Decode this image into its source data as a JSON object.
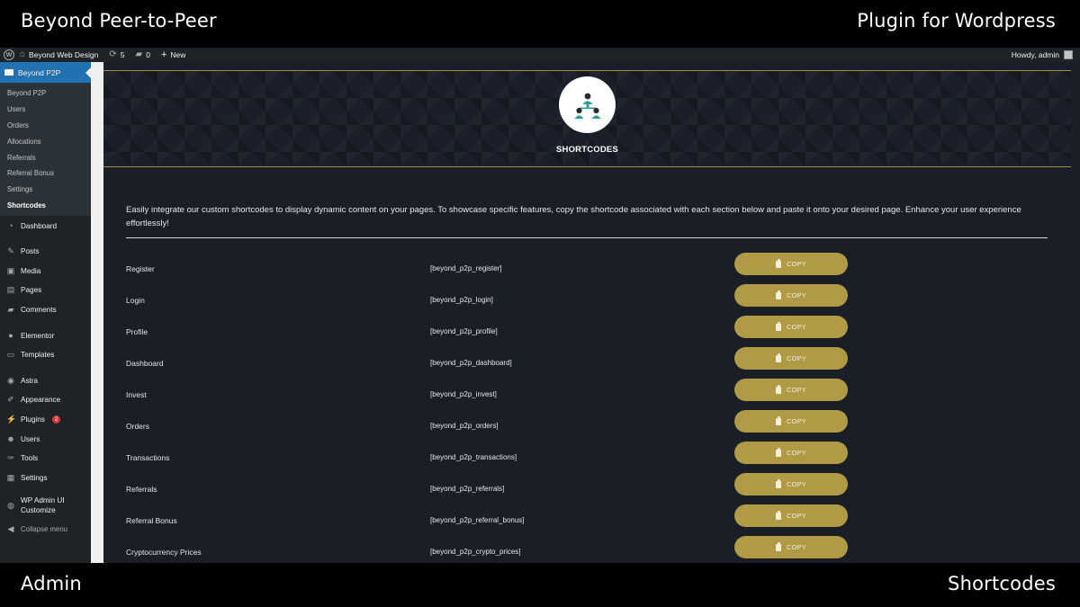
{
  "captions": {
    "top_left": "Beyond Peer-to-Peer",
    "top_right": "Plugin for Wordpress",
    "bottom_left": "Admin",
    "bottom_right": "Shortcodes"
  },
  "adminbar": {
    "site_name": "Beyond Web Design",
    "updates_count": "5",
    "comments_count": "0",
    "new_label": "New",
    "howdy": "Howdy, admin"
  },
  "sidebar": {
    "current": "Beyond P2P",
    "submenu": [
      "Beyond P2P",
      "Users",
      "Orders",
      "Allocations",
      "Referrals",
      "Referral Bonus",
      "Settings",
      "Shortcodes"
    ],
    "menu": {
      "dashboard": "Dashboard",
      "posts": "Posts",
      "media": "Media",
      "pages": "Pages",
      "comments": "Comments",
      "elementor": "Elementor",
      "templates": "Templates",
      "astra": "Astra",
      "appearance": "Appearance",
      "plugins": "Plugins",
      "plugins_badge": "2",
      "users": "Users",
      "tools": "Tools",
      "settings": "Settings",
      "wp_admin_ui_1": "WP Admin UI",
      "wp_admin_ui_2": "Customize",
      "collapse": "Collapse menu"
    }
  },
  "hero": {
    "title": "SHORTCODES",
    "icon": "people-network-icon"
  },
  "intro": "Easily integrate our custom shortcodes to display dynamic content on your pages. To showcase specific features, copy the shortcode associated with each section below and paste it onto your desired page. Enhance your user experience effortlessly!",
  "copy_label": "COPY",
  "shortcodes": [
    {
      "name": "Register",
      "code": "[beyond_p2p_register]"
    },
    {
      "name": "Login",
      "code": "[beyond_p2p_login]"
    },
    {
      "name": "Profile",
      "code": "[beyond_p2p_profile]"
    },
    {
      "name": "Dashboard",
      "code": "[beyond_p2p_dashboard]"
    },
    {
      "name": "Invest",
      "code": "[beyond_p2p_invest]"
    },
    {
      "name": "Orders",
      "code": "[beyond_p2p_orders]"
    },
    {
      "name": "Transactions",
      "code": "[beyond_p2p_transactions]"
    },
    {
      "name": "Referrals",
      "code": "[beyond_p2p_referrals]"
    },
    {
      "name": "Referral Bonus",
      "code": "[beyond_p2p_referral_bonus]"
    },
    {
      "name": "Cryptocurrency Prices",
      "code": "[beyond_p2p_crypto_prices]"
    }
  ],
  "colors": {
    "accent_gold": "#b09a45",
    "wp_blue": "#2271b1",
    "content_bg": "#1a1e27"
  }
}
